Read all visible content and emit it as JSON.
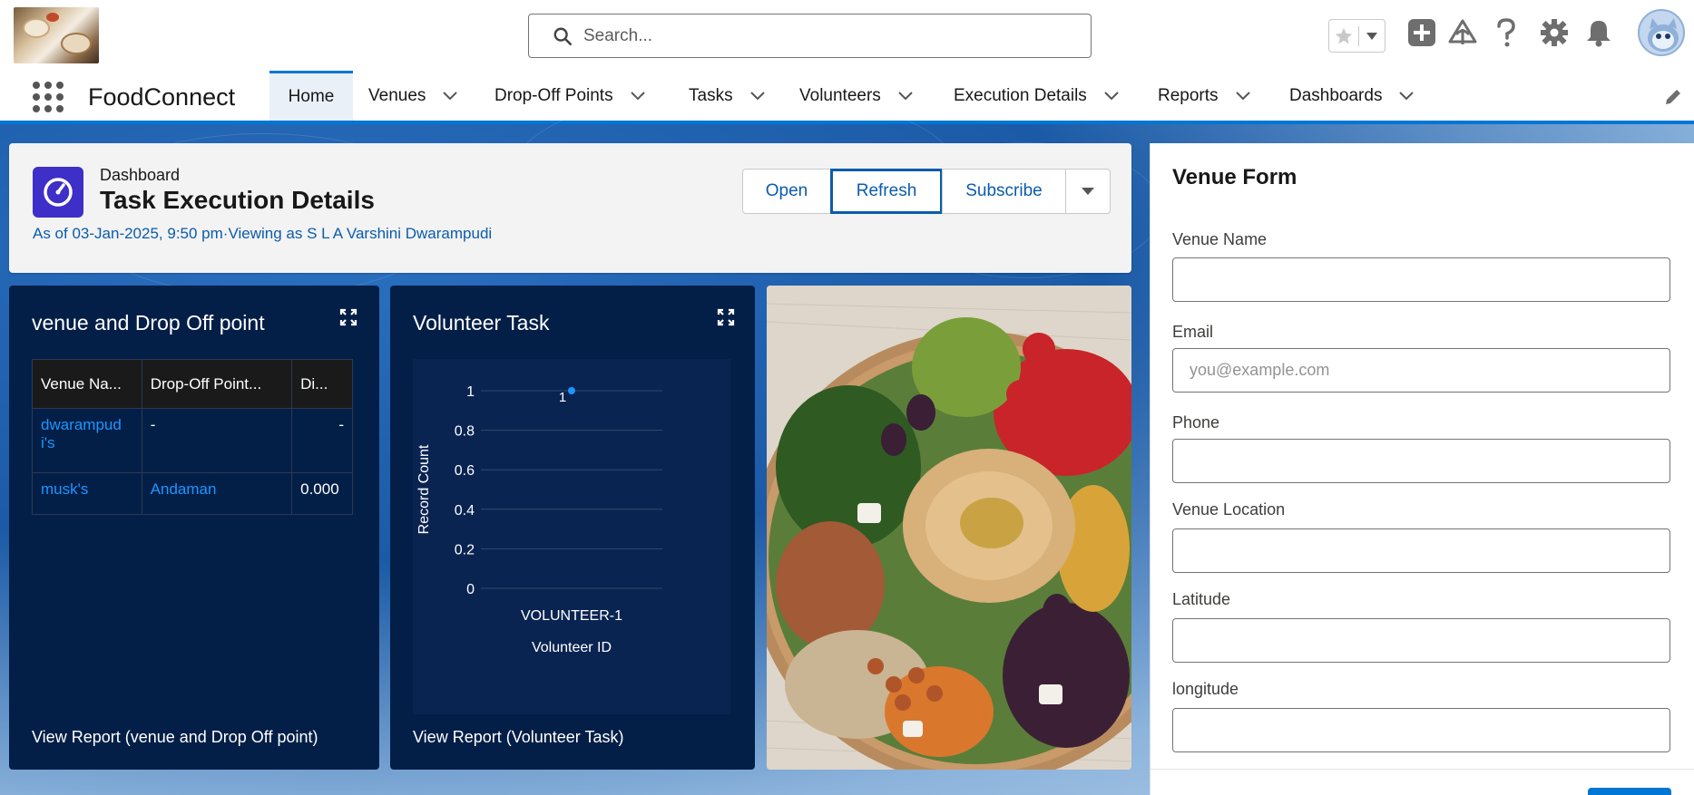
{
  "header": {
    "search_placeholder": "Search...",
    "icons": [
      "logo-image",
      "search-icon",
      "favorite-star-icon",
      "chevron-down-icon",
      "add-icon",
      "trailhead-icon",
      "help-icon",
      "setup-gear-icon",
      "notification-bell-icon",
      "user-avatar"
    ]
  },
  "nav": {
    "app_name": "FoodConnect",
    "tabs": [
      {
        "label": "Home"
      },
      {
        "label": "Venues"
      },
      {
        "label": "Drop-Off Points"
      },
      {
        "label": "Tasks"
      },
      {
        "label": "Volunteers"
      },
      {
        "label": "Execution Details"
      },
      {
        "label": "Reports"
      },
      {
        "label": "Dashboards"
      }
    ],
    "active_tab": "Home"
  },
  "dashboard": {
    "type_label": "Dashboard",
    "title": "Task Execution Details",
    "subtitle": "As of 03-Jan-2025, 9:50 pm·Viewing as S L A Varshini Dwarampudi",
    "buttons": {
      "open": "Open",
      "refresh": "Refresh",
      "subscribe": "Subscribe"
    },
    "widgets": {
      "table": {
        "title": "venue and Drop Off point",
        "columns": [
          "Venue Na...",
          "Drop-Off Point...",
          "Di..."
        ],
        "rows": [
          {
            "venue": "dwarampud i's",
            "dropoff": "-",
            "distance": "-"
          },
          {
            "venue": "musk's",
            "dropoff": "Andaman",
            "distance": "0.000"
          }
        ],
        "view_report": "View Report (venue and Drop Off point)"
      },
      "chart": {
        "title": "Volunteer Task",
        "view_report": "View Report (Volunteer Task)"
      }
    }
  },
  "chart_data": {
    "type": "scatter",
    "title": "Volunteer Task",
    "categories": [
      "VOLUNTEER-1"
    ],
    "values": [
      1
    ],
    "data_labels": [
      "1"
    ],
    "xlabel": "Volunteer ID",
    "ylabel": "Record Count",
    "ylim": [
      0,
      1
    ],
    "yticks": [
      "0",
      "0.2",
      "0.4",
      "0.6",
      "0.8",
      "1"
    ],
    "grid": true
  },
  "form": {
    "title": "Venue Form",
    "fields": [
      {
        "label": "Venue Name",
        "placeholder": "",
        "value": ""
      },
      {
        "label": "Email",
        "placeholder": "you@example.com",
        "value": ""
      },
      {
        "label": "Phone",
        "placeholder": "",
        "value": ""
      },
      {
        "label": "Venue Location",
        "placeholder": "",
        "value": ""
      },
      {
        "label": "Latitude",
        "placeholder": "",
        "value": ""
      },
      {
        "label": "longitude",
        "placeholder": "",
        "value": ""
      }
    ]
  },
  "colors": {
    "brand": "#0176d3",
    "link": "#0b5cab",
    "widget_bg": "#041f47",
    "dashboard_icon": "#3d2fc7"
  }
}
